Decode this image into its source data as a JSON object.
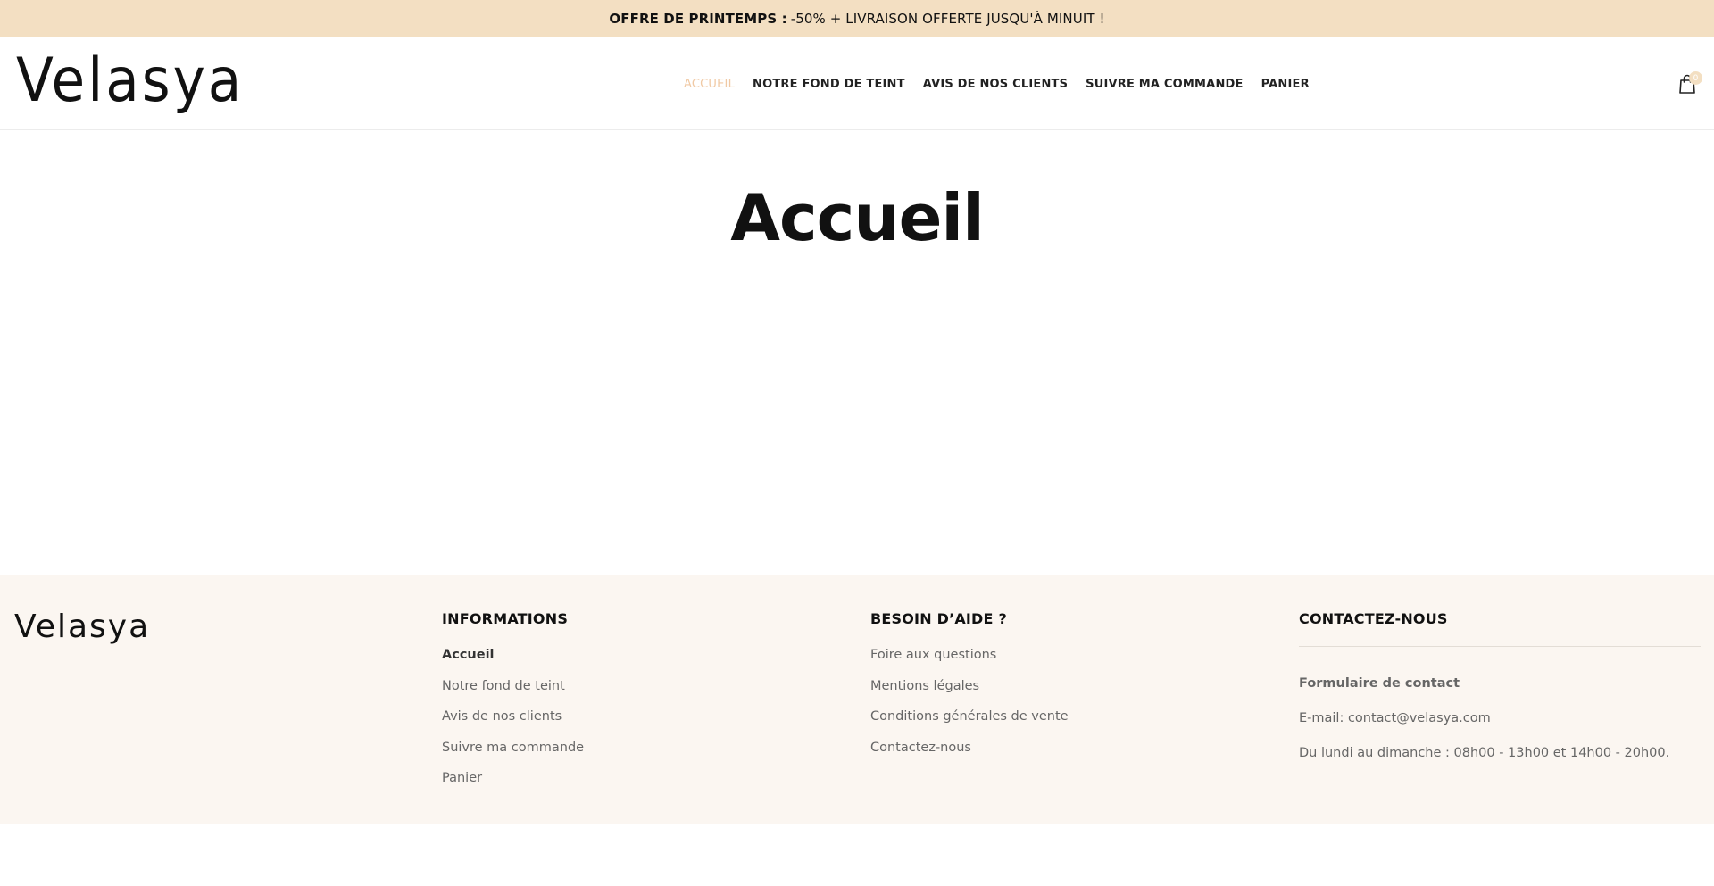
{
  "announcement": {
    "label": "OFFRE DE PRINTEMPS :",
    "text": "-50% + LIVRAISON OFFERTE JUSQU'À MINUIT !"
  },
  "header": {
    "logo": "Velasya",
    "nav": [
      {
        "label": "ACCUEIL",
        "active": true
      },
      {
        "label": "NOTRE FOND DE TEINT",
        "active": false
      },
      {
        "label": "AVIS DE NOS CLIENTS",
        "active": false
      },
      {
        "label": "SUIVRE MA COMMANDE",
        "active": false
      },
      {
        "label": "PANIER",
        "active": false
      }
    ],
    "cart_icon": "shopping-bag-icon",
    "cart_count": "0"
  },
  "main": {
    "title": "Accueil"
  },
  "footer": {
    "logo": "Velasya",
    "informations": {
      "heading": "INFORMATIONS",
      "links": [
        "Accueil",
        "Notre fond de teint",
        "Avis de nos clients",
        "Suivre ma commande",
        "Panier"
      ]
    },
    "aide": {
      "heading": "BESOIN D’AIDE ?",
      "links": [
        "Foire aux questions",
        "Mentions légales",
        "Conditions générales de vente",
        "Contactez-nous"
      ]
    },
    "contact": {
      "heading": "CONTACTEZ-NOUS",
      "form_link": "Formulaire de contact",
      "email": "E-mail: contact@velasya.com",
      "hours": "Du lundi au dimanche : 08h00 - 13h00 et 14h00 - 20h00."
    }
  },
  "colors": {
    "announcement_bg": "#f3dfc2",
    "nav_active": "#f0c9a4",
    "footer_bg": "#fbf6f1"
  }
}
